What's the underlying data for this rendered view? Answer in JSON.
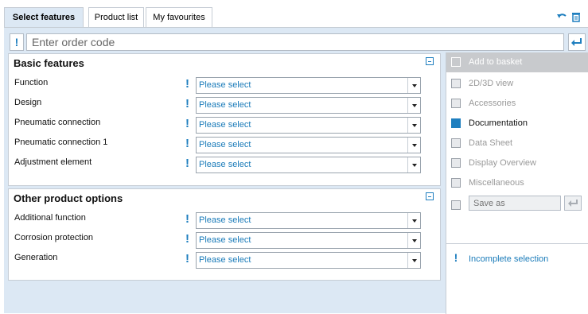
{
  "tabs": [
    {
      "label": "Select features",
      "active": true
    },
    {
      "label": "Product list",
      "active": false
    },
    {
      "label": "My favourites",
      "active": false
    }
  ],
  "top_icons": [
    "undo-icon",
    "trash-icon"
  ],
  "order_code": {
    "placeholder": "Enter order code",
    "value": ""
  },
  "basic_features": {
    "title": "Basic features",
    "rows": [
      {
        "label": "Function",
        "value": "Please select"
      },
      {
        "label": "Design",
        "value": "Please select"
      },
      {
        "label": "Pneumatic connection",
        "value": "Please select"
      },
      {
        "label": "Pneumatic connection 1",
        "value": "Please select"
      },
      {
        "label": "Adjustment element",
        "value": "Please select"
      }
    ]
  },
  "other_options": {
    "title": "Other product options",
    "rows": [
      {
        "label": "Additional function",
        "value": "Please select"
      },
      {
        "label": "Corrosion protection",
        "value": "Please select"
      },
      {
        "label": "Generation",
        "value": "Please select"
      }
    ]
  },
  "sidebar": {
    "items": [
      {
        "label": "Add to basket",
        "icon": "basket-icon",
        "enabled": false
      },
      {
        "label": "2D/3D view",
        "icon": "cad-icon",
        "enabled": false
      },
      {
        "label": "Accessories",
        "icon": "accessories-icon",
        "enabled": false
      },
      {
        "label": "Documentation",
        "icon": "pdf-icon",
        "enabled": true
      },
      {
        "label": "Data Sheet",
        "icon": "datasheet-icon",
        "enabled": false
      },
      {
        "label": "Display Overview",
        "icon": "printer-icon",
        "enabled": false
      },
      {
        "label": "Miscellaneous",
        "icon": "plus-icon",
        "enabled": false
      }
    ],
    "save_as_placeholder": "Save as",
    "status": "Incomplete selection"
  },
  "colors": {
    "accent": "#1f7fbf",
    "panel_bg": "#dce8f4",
    "border": "#c6cdd5"
  }
}
